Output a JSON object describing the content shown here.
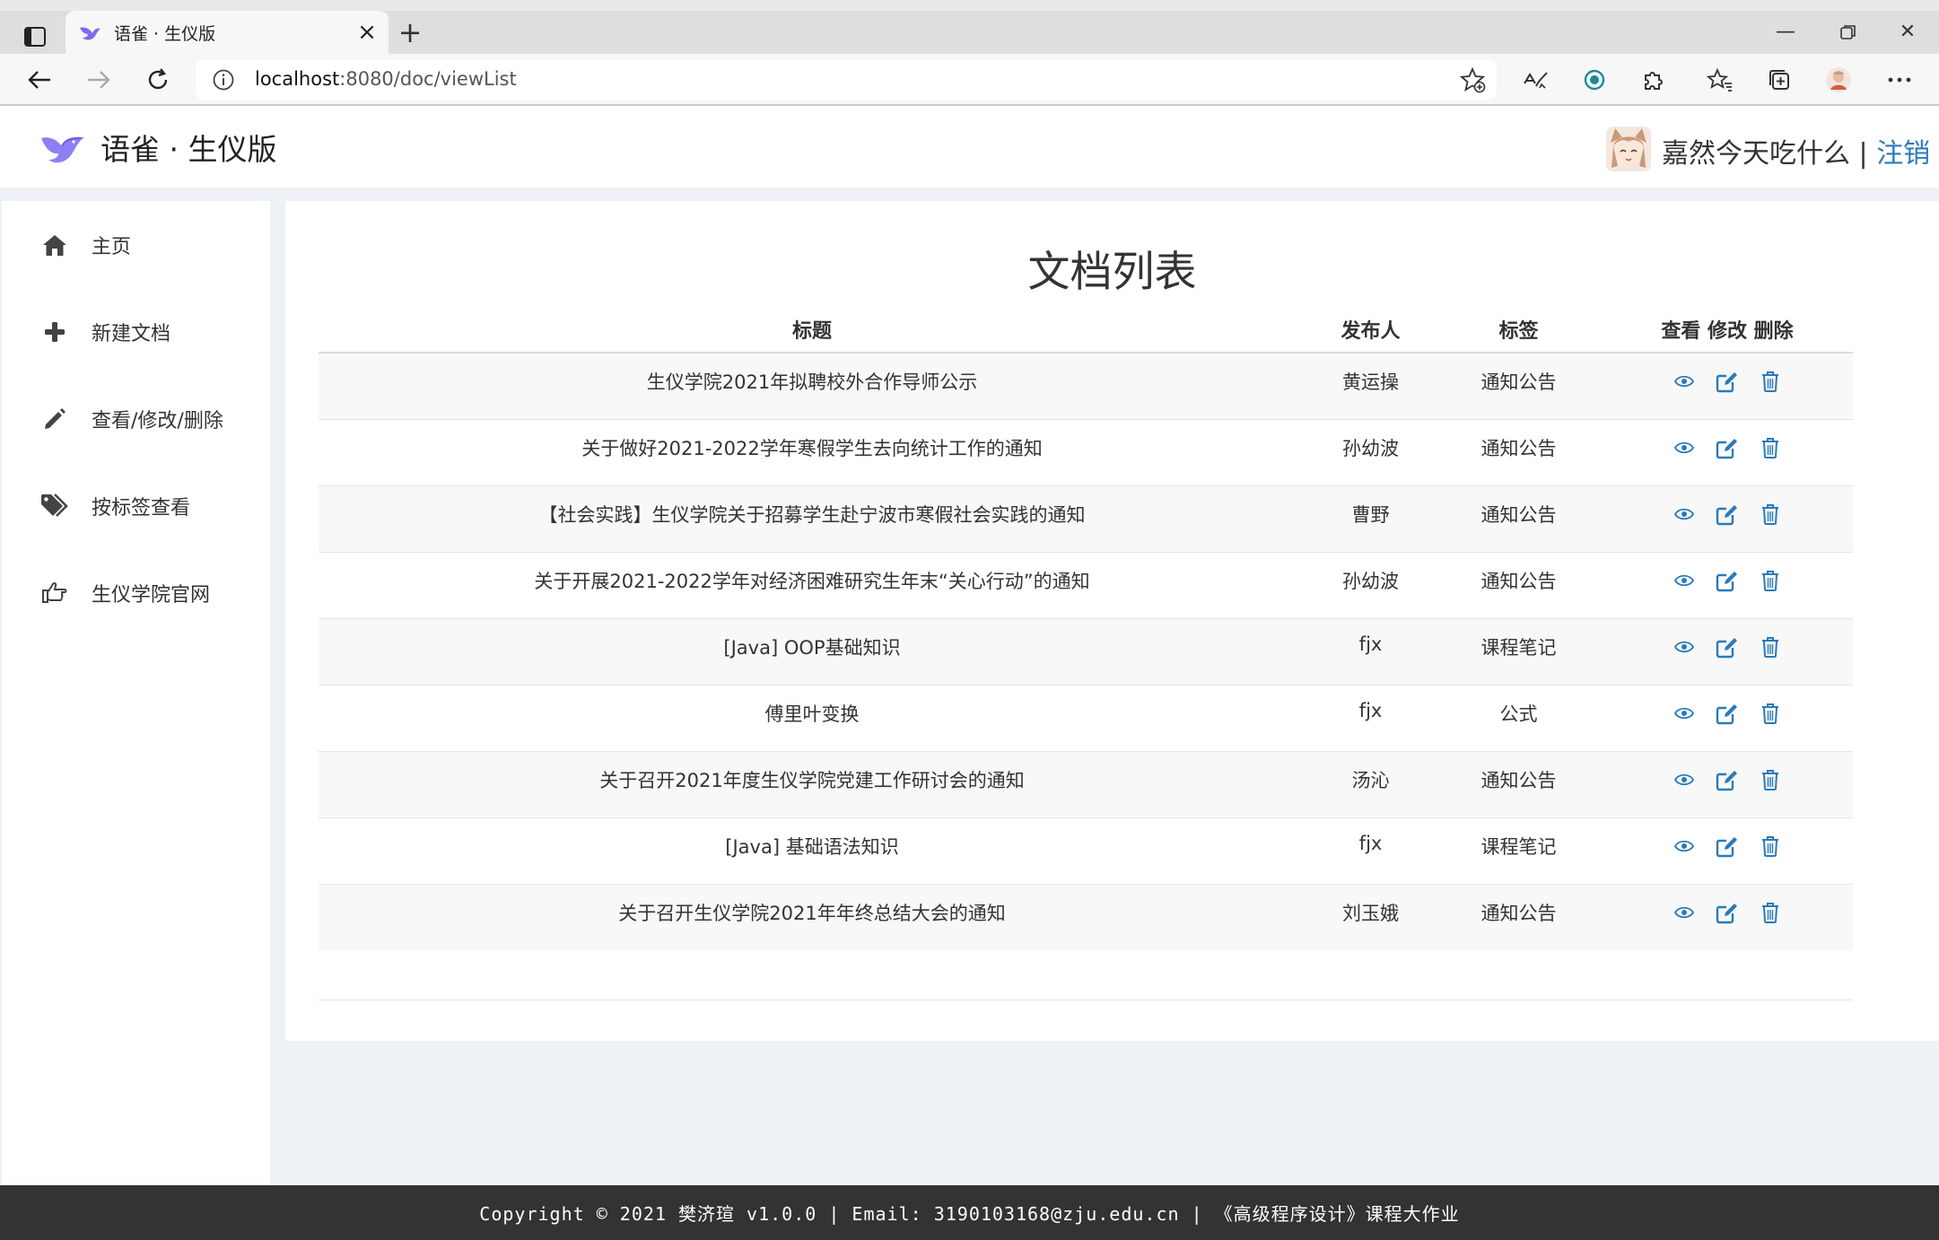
{
  "browser": {
    "tab_title": "语雀 · 生仪版",
    "url_host": "localhost",
    "url_rest": ":8080/doc/viewList"
  },
  "header": {
    "app_title": "语雀 · 生仪版",
    "user_name": "嘉然今天吃什么",
    "separator": " | ",
    "logout_label": "注销"
  },
  "sidebar": {
    "items": [
      {
        "label": "主页",
        "icon": "home-icon"
      },
      {
        "label": "新建文档",
        "icon": "plus-icon"
      },
      {
        "label": "查看/修改/删除",
        "icon": "pencil-icon"
      },
      {
        "label": "按标签查看",
        "icon": "tags-icon"
      },
      {
        "label": "生仪学院官网",
        "icon": "hand-pointer-icon"
      }
    ]
  },
  "main": {
    "title": "文档列表",
    "columns": {
      "title": "标题",
      "author": "发布人",
      "tag": "标签",
      "actions": "查看 修改 删除"
    },
    "rows": [
      {
        "title": "生仪学院2021年拟聘校外合作导师公示",
        "author": "黄运操",
        "tag": "通知公告"
      },
      {
        "title": "关于做好2021-2022学年寒假学生去向统计工作的通知",
        "author": "孙幼波",
        "tag": "通知公告"
      },
      {
        "title": "【社会实践】生仪学院关于招募学生赴宁波市寒假社会实践的通知",
        "author": "曹野",
        "tag": "通知公告"
      },
      {
        "title": "关于开展2021-2022学年对经济困难研究生年末“关心行动”的通知",
        "author": "孙幼波",
        "tag": "通知公告"
      },
      {
        "title": "[Java] OOP基础知识",
        "author": "fjx",
        "tag": "课程笔记"
      },
      {
        "title": "傅里叶变换",
        "author": "fjx",
        "tag": "公式"
      },
      {
        "title": "关于召开2021年度生仪学院党建工作研讨会的通知",
        "author": "汤沁",
        "tag": "通知公告"
      },
      {
        "title": "[Java] 基础语法知识",
        "author": "fjx",
        "tag": "课程笔记"
      },
      {
        "title": "关于召开生仪学院2021年年终总结大会的通知",
        "author": "刘玉娥",
        "tag": "通知公告"
      }
    ]
  },
  "footer": {
    "text": "Copyright © 2021 樊济瑄 v1.0.0 | Email: 3190103168@zju.edu.cn | 《高级程序设计》课程大作业"
  },
  "colors": {
    "accent": "#2a7ab8",
    "footer_bg": "#333333",
    "page_bg": "#eef2f7"
  }
}
